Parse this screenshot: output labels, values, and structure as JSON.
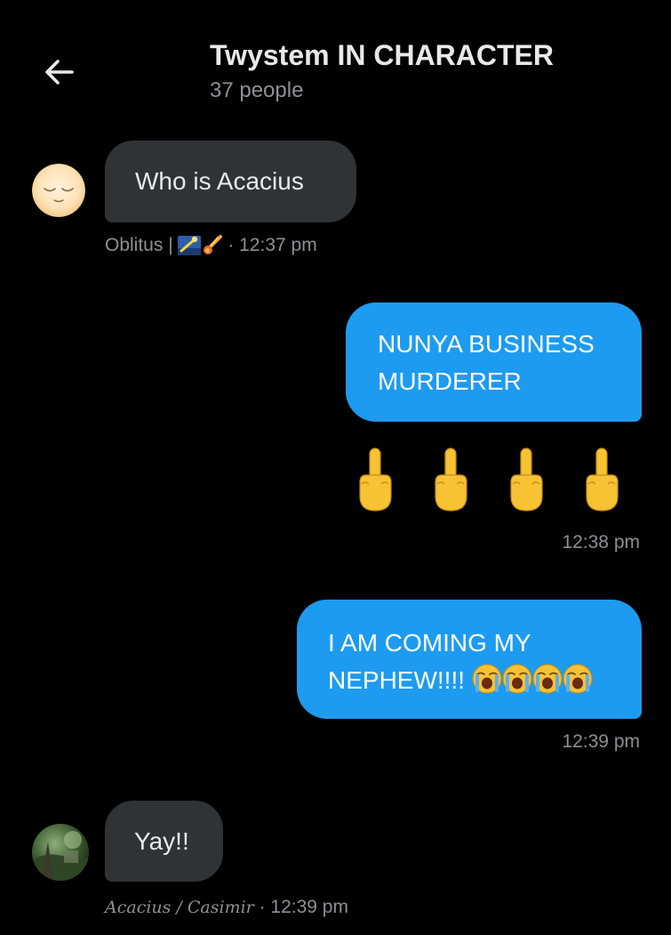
{
  "header": {
    "title": "Twystem IN CHARACTER",
    "subtitle": "37 people",
    "back_icon": "arrow-left-icon"
  },
  "messages": [
    {
      "direction": "incoming",
      "text": "Who is Acacius",
      "sender": "Oblitus | ",
      "sender_emoji": [
        "shooting-star-icon",
        "comet-icon"
      ],
      "separator": " · ",
      "time": "12:37 pm",
      "avatar": "sleeping-face-avatar"
    },
    {
      "direction": "outgoing",
      "text_line1": "NUNYA BUSINESS",
      "text_line2": "MURDERER"
    },
    {
      "direction": "outgoing",
      "emoji": [
        "middle-finger-icon",
        "middle-finger-icon",
        "middle-finger-icon",
        "middle-finger-icon"
      ],
      "time": "12:38 pm"
    },
    {
      "direction": "outgoing",
      "text_line1": "I AM COMING MY",
      "text_line2": "NEPHEW!!!! ",
      "emoji": [
        "loudly-crying-face-icon",
        "loudly-crying-face-icon",
        "loudly-crying-face-icon",
        "loudly-crying-face-icon"
      ],
      "time": "12:39 pm"
    },
    {
      "direction": "incoming",
      "text": "Yay!!",
      "sender": "Acacius / Casimir",
      "separator": " · ",
      "time": "12:39 pm",
      "avatar": "forest-photo-avatar"
    }
  ],
  "colors": {
    "background": "#000000",
    "incoming_bubble": "#2f3336",
    "outgoing_bubble": "#1d9bf0",
    "muted_text": "#8b9096",
    "primary_text": "#e7e9ea",
    "emoji_yellow": "#f7c234"
  }
}
